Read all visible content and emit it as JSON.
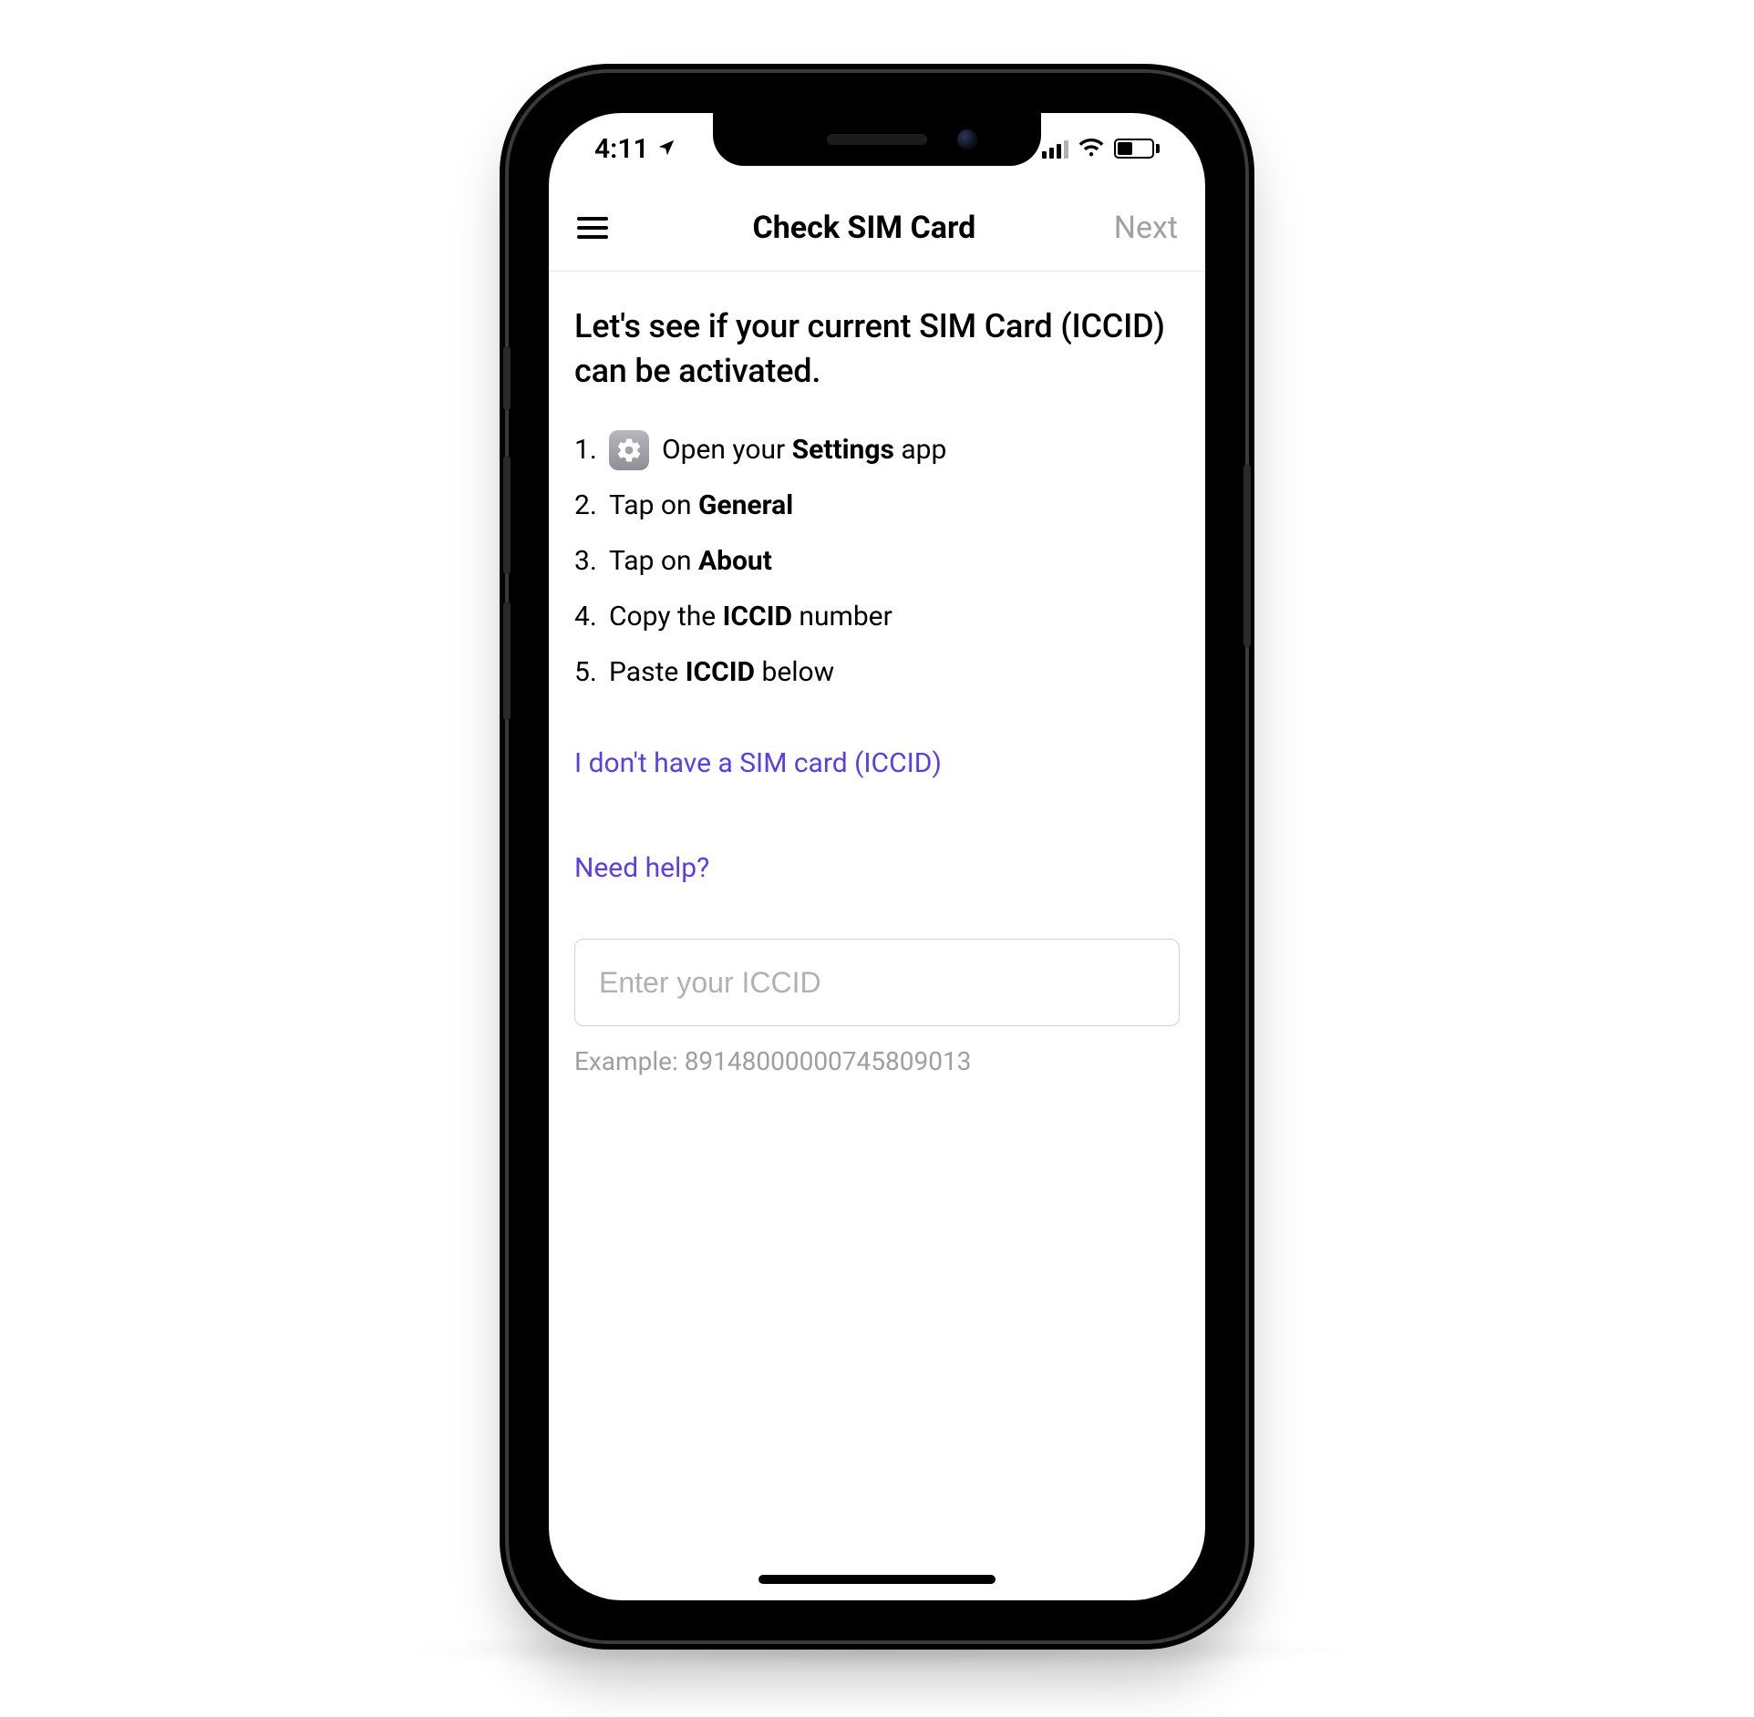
{
  "status": {
    "time": "4:11",
    "location_active": true,
    "signal_bars_filled": 3,
    "signal_bars_total": 4,
    "wifi": true,
    "battery_percent": 45
  },
  "nav": {
    "title": "Check SIM Card",
    "next_label": "Next"
  },
  "content": {
    "heading": "Let's see if your current SIM Card (ICCID) can be activated.",
    "steps": [
      {
        "num": "1.",
        "before": "Open your ",
        "bold": "Settings",
        "after": " app",
        "icon": "settings"
      },
      {
        "num": "2.",
        "before": "Tap on ",
        "bold": "General",
        "after": ""
      },
      {
        "num": "3.",
        "before": "Tap on ",
        "bold": "About",
        "after": ""
      },
      {
        "num": "4.",
        "before": "Copy the ",
        "bold": "ICCID",
        "after": " number"
      },
      {
        "num": "5.",
        "before": "Paste ",
        "bold": "ICCID",
        "after": " below"
      }
    ],
    "link_no_sim": "I don't have a SIM card (ICCID)",
    "link_help": "Need help?",
    "input_placeholder": "Enter your ICCID",
    "input_value": "",
    "example_text": "Example: 89148000000745809013"
  },
  "colors": {
    "link": "#5a3ee6",
    "muted": "#9e9ea3",
    "border": "#d1d1d6"
  }
}
